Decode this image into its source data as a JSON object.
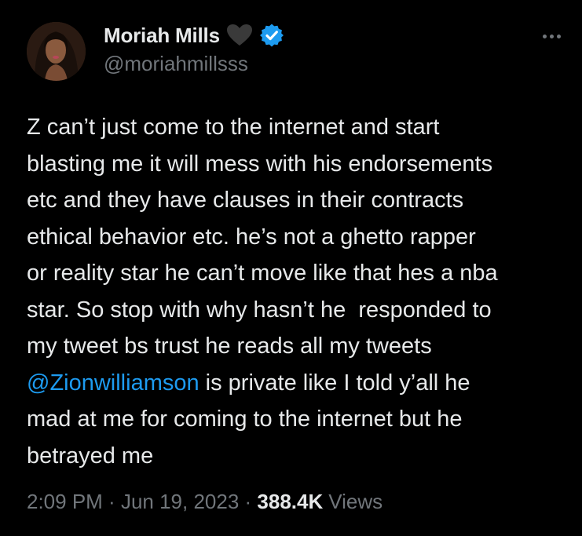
{
  "author": {
    "display_name": "Moriah Mills",
    "handle": "@moriahmillsss",
    "heart_icon": "black-heart-icon",
    "verified_icon": "verified-badge-icon",
    "verified_color": "#1d9bf0"
  },
  "tweet": {
    "lines": [
      "Z can’t just come to the internet and start",
      "blasting me it will mess with his endorsements",
      "etc and they have clauses in their contracts",
      "ethical behavior etc. he’s not a ghetto rapper",
      "or reality star he can’t move like that hes a nba",
      "star. So stop with why hasn’t he  responded to",
      "my tweet bs trust he reads all my tweets"
    ],
    "mention": "@Zionwilliamson",
    "mention_line_rest": " is private like I told y’all he",
    "lines_after": [
      "mad at me for coming to the internet but he",
      "betrayed me"
    ]
  },
  "meta": {
    "time": "2:09 PM",
    "separator": " · ",
    "date": "Jun 19, 2023",
    "views_count": "388.4K",
    "views_label": "Views"
  },
  "colors": {
    "background": "#000000",
    "text": "#e7e9ea",
    "secondary": "#71767b",
    "link": "#1d9bf0"
  }
}
